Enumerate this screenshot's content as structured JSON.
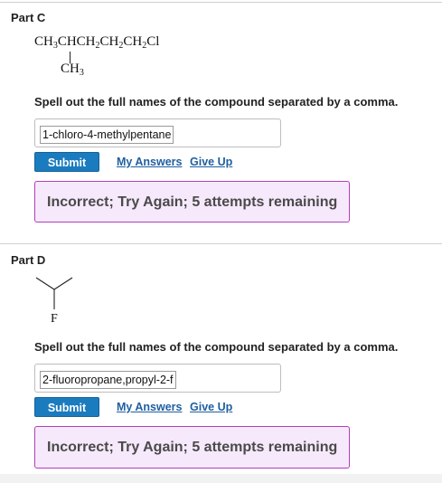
{
  "partC": {
    "title": "Part C",
    "formula_main": "CH₃CHCH₂CH₂CH₂Cl",
    "formula_branch": "CH₃",
    "prompt": "Spell out the full names of the compound separated by a comma.",
    "answer_value": "1-chloro-4-methylpentane",
    "submit_label": "Submit",
    "my_answers_label": "My Answers",
    "give_up_label": "Give Up",
    "feedback": "Incorrect; Try Again; 5 attempts remaining"
  },
  "partD": {
    "title": "Part D",
    "structure_atom": "F",
    "prompt": "Spell out the full names of the compound separated by a comma.",
    "answer_value": "2-fluoropropane,propyl-2-f",
    "submit_label": "Submit",
    "my_answers_label": "My Answers",
    "give_up_label": "Give Up",
    "feedback": "Incorrect; Try Again; 5 attempts remaining"
  },
  "colors": {
    "submit_bg": "#1b7bbf",
    "link": "#1f5fa0",
    "feedback_bg": "#f6e9fb",
    "feedback_border": "#b03fb9"
  }
}
